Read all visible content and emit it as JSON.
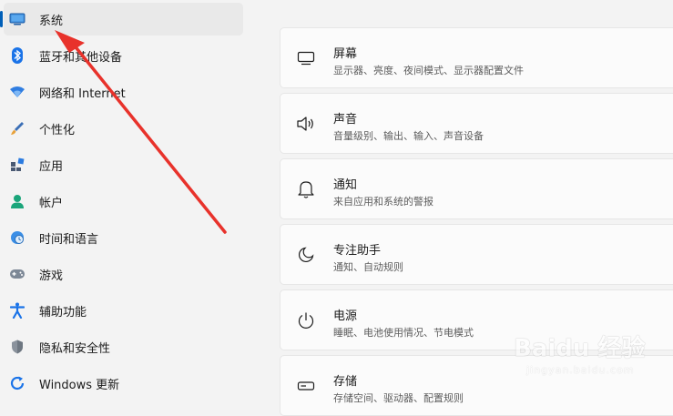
{
  "sidebar": {
    "items": [
      {
        "label": "系统",
        "icon": "monitor-icon",
        "active": true
      },
      {
        "label": "蓝牙和其他设备",
        "icon": "bluetooth-icon"
      },
      {
        "label": "网络和 Internet",
        "icon": "wifi-icon"
      },
      {
        "label": "个性化",
        "icon": "brush-icon"
      },
      {
        "label": "应用",
        "icon": "apps-icon"
      },
      {
        "label": "帐户",
        "icon": "account-icon"
      },
      {
        "label": "时间和语言",
        "icon": "globe-clock-icon"
      },
      {
        "label": "游戏",
        "icon": "gamepad-icon"
      },
      {
        "label": "辅助功能",
        "icon": "accessibility-icon"
      },
      {
        "label": "隐私和安全性",
        "icon": "shield-icon"
      },
      {
        "label": "Windows 更新",
        "icon": "windows-update-icon"
      }
    ]
  },
  "cards": [
    {
      "title": "屏幕",
      "desc": "显示器、亮度、夜间模式、显示器配置文件",
      "icon": "display-icon"
    },
    {
      "title": "声音",
      "desc": "音量级别、输出、输入、声音设备",
      "icon": "speaker-icon"
    },
    {
      "title": "通知",
      "desc": "来自应用和系统的警报",
      "icon": "bell-icon"
    },
    {
      "title": "专注助手",
      "desc": "通知、自动规则",
      "icon": "moon-icon"
    },
    {
      "title": "电源",
      "desc": "睡眠、电池使用情况、节电模式",
      "icon": "power-icon"
    },
    {
      "title": "存储",
      "desc": "存储空间、驱动器、配置规则",
      "icon": "storage-icon"
    }
  ],
  "watermark": {
    "main": "Baidu 经验",
    "sub": "jingyan.baidu.com"
  },
  "colors": {
    "accent": "#005fb8",
    "arrow": "#e8322b"
  }
}
